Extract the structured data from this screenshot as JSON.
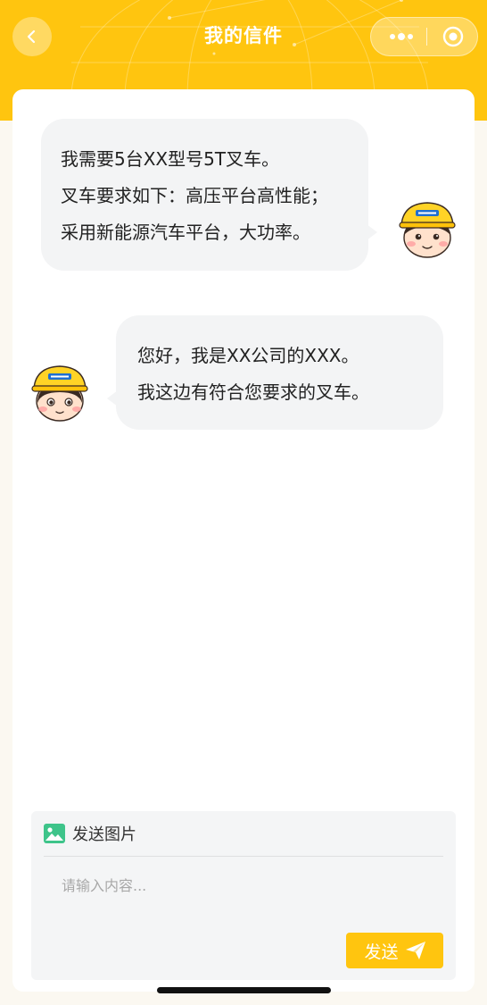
{
  "header": {
    "title": "我的信件",
    "back_icon": "chevron-left-icon",
    "more_icon": "more-dots-icon",
    "close_icon": "target-circle-icon",
    "bg_color": "#ffc50f"
  },
  "messages": [
    {
      "from": "user",
      "avatar_icon": "worker-avatar-icon",
      "lines": [
        "我需要5台XX型号5T叉车。",
        "叉车要求如下：高压平台高性能；",
        "采用新能源汽车平台，大功率。"
      ]
    },
    {
      "from": "agent",
      "avatar_icon": "worker-avatar-icon",
      "lines": [
        "您好，我是XX公司的XXX。",
        "我这边有符合您要求的叉车。"
      ]
    }
  ],
  "composer": {
    "image_picker_label": "发送图片",
    "image_icon": "image-icon",
    "input_placeholder": "请输入内容...",
    "input_value": "",
    "send_label": "发送",
    "send_icon": "paper-plane-icon",
    "accent_color": "#ffc50f"
  }
}
